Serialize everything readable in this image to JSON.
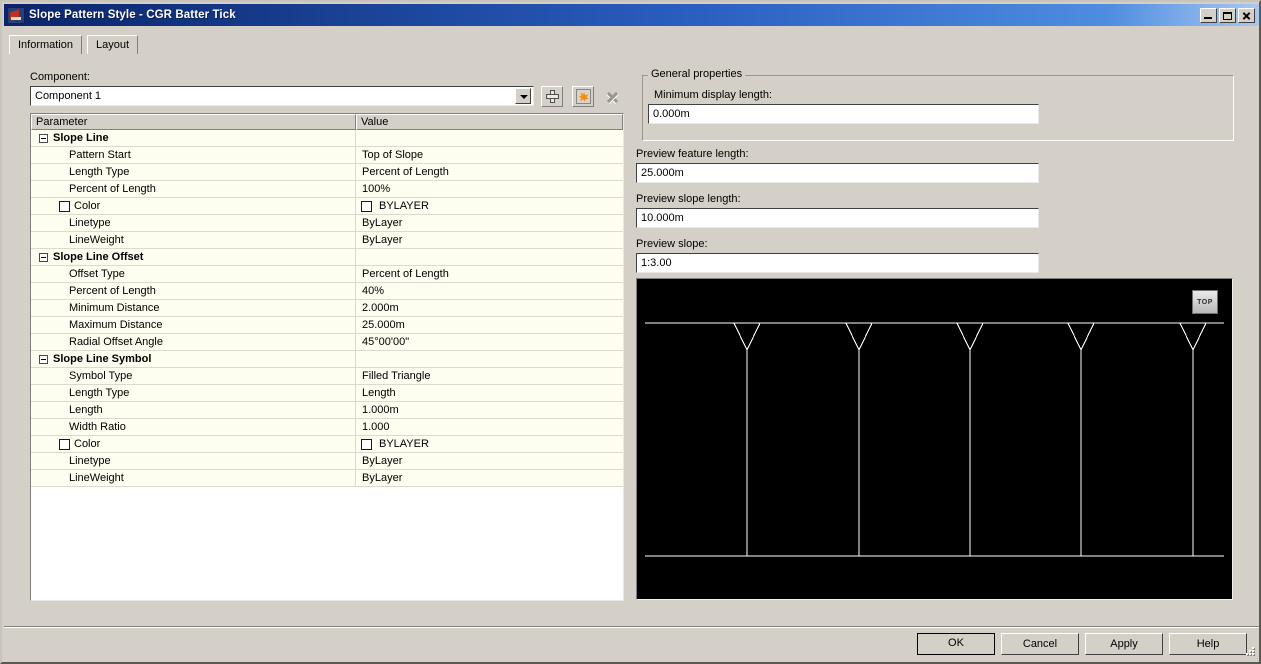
{
  "window": {
    "title": "Slope Pattern Style - CGR Batter Tick",
    "icon": "app-icon",
    "buttons": {
      "minimize": "minimize-icon",
      "maximize": "maximize-icon",
      "close": "close-icon"
    }
  },
  "tabs": [
    {
      "label": "Information",
      "active": false
    },
    {
      "label": "Layout",
      "active": true
    }
  ],
  "component": {
    "label": "Component:",
    "value": "Component 1",
    "dropdown_icon": "chevron-down-icon",
    "actions": [
      {
        "name": "add-component-button",
        "icon": "plus-icon",
        "enabled": true
      },
      {
        "name": "copy-component-button",
        "icon": "burst-icon",
        "enabled": true
      },
      {
        "name": "delete-component-button",
        "icon": "x-icon",
        "enabled": false
      }
    ]
  },
  "grid": {
    "columns": [
      "Parameter",
      "Value"
    ],
    "rows": [
      {
        "type": "group",
        "parameter": "Slope Line",
        "value": ""
      },
      {
        "type": "item",
        "parameter": "Pattern Start",
        "value": "Top of Slope"
      },
      {
        "type": "item",
        "parameter": "Length Type",
        "value": "Percent of Length"
      },
      {
        "type": "item",
        "parameter": "Percent of Length",
        "value": "100%"
      },
      {
        "type": "color",
        "parameter": "Color",
        "value": "BYLAYER",
        "swatch": "#ffffff"
      },
      {
        "type": "item",
        "parameter": "Linetype",
        "value": "ByLayer"
      },
      {
        "type": "item",
        "parameter": "LineWeight",
        "value": "ByLayer"
      },
      {
        "type": "group",
        "parameter": "Slope Line Offset",
        "value": ""
      },
      {
        "type": "item",
        "parameter": "Offset Type",
        "value": "Percent of Length"
      },
      {
        "type": "item",
        "parameter": "Percent of Length",
        "value": "40%"
      },
      {
        "type": "item",
        "parameter": "Minimum Distance",
        "value": "2.000m"
      },
      {
        "type": "item",
        "parameter": "Maximum Distance",
        "value": "25.000m"
      },
      {
        "type": "item",
        "parameter": "Radial Offset Angle",
        "value": "45°00'00\""
      },
      {
        "type": "group",
        "parameter": "Slope Line Symbol",
        "value": ""
      },
      {
        "type": "item",
        "parameter": "Symbol Type",
        "value": "Filled Triangle"
      },
      {
        "type": "item",
        "parameter": "Length Type",
        "value": "Length"
      },
      {
        "type": "item",
        "parameter": "Length",
        "value": "1.000m"
      },
      {
        "type": "item",
        "parameter": "Width Ratio",
        "value": "1.000"
      },
      {
        "type": "color",
        "parameter": "Color",
        "value": "BYLAYER",
        "swatch": "#ffffff"
      },
      {
        "type": "item",
        "parameter": "Linetype",
        "value": "ByLayer"
      },
      {
        "type": "item",
        "parameter": "LineWeight",
        "value": "ByLayer"
      }
    ]
  },
  "general_properties": {
    "legend": "General properties",
    "min_display_length": {
      "label": "Minimum display length:",
      "value": "0.000m"
    }
  },
  "preview_fields": [
    {
      "label": "Preview feature length:",
      "value": "25.000m"
    },
    {
      "label": "Preview slope length:",
      "value": "10.000m"
    },
    {
      "label": "Preview slope:",
      "value": "1:3.00"
    }
  ],
  "preview": {
    "background": "#000000",
    "stroke": "#ffffff",
    "viewcube_label": "TOP",
    "tick_count": 5
  },
  "footer": {
    "ok": "OK",
    "cancel": "Cancel",
    "apply": "Apply",
    "help": "Help"
  }
}
